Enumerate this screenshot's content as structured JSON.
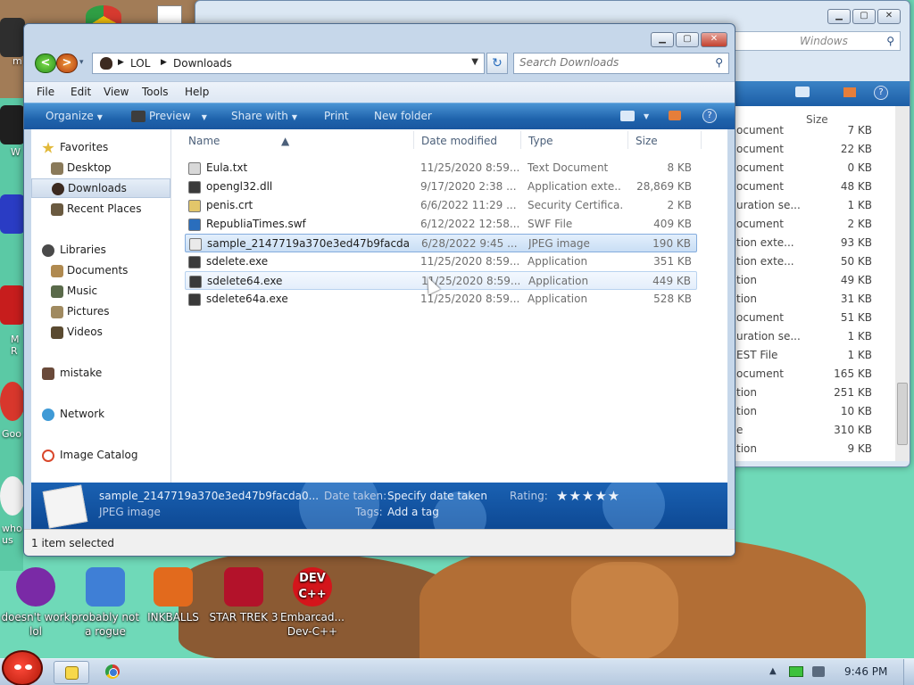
{
  "desktop": {
    "bottom_icons": [
      {
        "label": "doesn't work lol",
        "icon": "yahoo-messenger-icon",
        "color": "#7a2aa6"
      },
      {
        "label": "probably not a rogue",
        "icon": "system-tool-icon",
        "color": "#3f7fd6"
      },
      {
        "label": "INKBALLS",
        "icon": "inkball-icon",
        "color": "#e26a1d"
      },
      {
        "label": "STAR TREK 3",
        "icon": "star-wars-game-icon",
        "color": "#b3122a"
      },
      {
        "label": "Embarcad... Dev-C++",
        "icon": "dev-cpp-icon",
        "color": "#d4151b"
      }
    ],
    "dev_icon_text": "DEV C++",
    "left_icon_labels": [
      "m",
      "W",
      "M R",
      "Goo",
      "who us"
    ]
  },
  "background_window": {
    "search_placeholder": "Windows",
    "size_header": "Size",
    "rows": [
      {
        "type": "ocument",
        "size": "7 KB"
      },
      {
        "type": "ocument",
        "size": "22 KB"
      },
      {
        "type": "ocument",
        "size": "0 KB"
      },
      {
        "type": "ocument",
        "size": "48 KB"
      },
      {
        "type": "uration se...",
        "size": "1 KB"
      },
      {
        "type": "ocument",
        "size": "2 KB"
      },
      {
        "type": "tion exte...",
        "size": "93 KB"
      },
      {
        "type": "tion exte...",
        "size": "50 KB"
      },
      {
        "type": "tion",
        "size": "49 KB"
      },
      {
        "type": "tion",
        "size": "31 KB"
      },
      {
        "type": "ocument",
        "size": "51 KB"
      },
      {
        "type": "uration se...",
        "size": "1 KB"
      },
      {
        "type": "EST File",
        "size": "1 KB"
      },
      {
        "type": "ocument",
        "size": "165 KB"
      },
      {
        "type": "tion",
        "size": "251 KB"
      },
      {
        "type": "tion",
        "size": "10 KB"
      },
      {
        "type": "e",
        "size": "310 KB"
      },
      {
        "type": "tion",
        "size": "9 KB"
      }
    ]
  },
  "explorer": {
    "breadcrumb": [
      "LOL",
      "Downloads"
    ],
    "search_placeholder": "Search Downloads",
    "menu": [
      "File",
      "Edit",
      "View",
      "Tools",
      "Help"
    ],
    "commands": {
      "organize": "Organize",
      "preview": "Preview",
      "share_with": "Share with",
      "print": "Print",
      "new_folder": "New folder"
    },
    "nav": {
      "favorites": "Favorites",
      "desktop": "Desktop",
      "downloads": "Downloads",
      "recent_places": "Recent Places",
      "libraries": "Libraries",
      "documents": "Documents",
      "music": "Music",
      "pictures": "Pictures",
      "videos": "Videos",
      "mistake": "mistake",
      "network": "Network",
      "image_catalog": "Image Catalog"
    },
    "columns": {
      "name": "Name",
      "date_modified": "Date modified",
      "type": "Type",
      "size": "Size"
    },
    "files": [
      {
        "name": "Eula.txt",
        "date": "11/25/2020 8:59...",
        "type": "Text Document",
        "size": "8 KB",
        "icon_color": "#d8d8d8"
      },
      {
        "name": "opengl32.dll",
        "date": "9/17/2020 2:38 ...",
        "type": "Application exte...",
        "size": "28,869 KB",
        "icon_color": "#3a3a3a"
      },
      {
        "name": "penis.crt",
        "date": "6/6/2022 11:29 ...",
        "type": "Security Certifica...",
        "size": "2 KB",
        "icon_color": "#e2c66a"
      },
      {
        "name": "RepubliaTimes.swf",
        "date": "6/12/2022 12:58...",
        "type": "SWF File",
        "size": "409 KB",
        "icon_color": "#2a6ebd"
      },
      {
        "name": "sample_2147719a370e3ed47b9facda...",
        "date": "6/28/2022 9:45 ...",
        "type": "JPEG image",
        "size": "190 KB",
        "icon_color": "#eaeaea"
      },
      {
        "name": "sdelete.exe",
        "date": "11/25/2020 8:59...",
        "type": "Application",
        "size": "351 KB",
        "icon_color": "#3a3a3a"
      },
      {
        "name": "sdelete64.exe",
        "date": "11/25/2020 8:59...",
        "type": "Application",
        "size": "449 KB",
        "icon_color": "#3a3a3a"
      },
      {
        "name": "sdelete64a.exe",
        "date": "11/25/2020 8:59...",
        "type": "Application",
        "size": "528 KB",
        "icon_color": "#3a3a3a"
      }
    ],
    "details": {
      "filename": "sample_2147719a370e3ed47b9facda0...",
      "filetype": "JPEG image",
      "date_taken_label": "Date taken:",
      "date_taken_value": "Specify date taken",
      "tags_label": "Tags:",
      "tags_value": "Add a tag",
      "rating_label": "Rating:",
      "rating_stars": "★★★★★"
    },
    "status": "1 item selected"
  },
  "taskbar": {
    "clock": "9:46 PM"
  }
}
